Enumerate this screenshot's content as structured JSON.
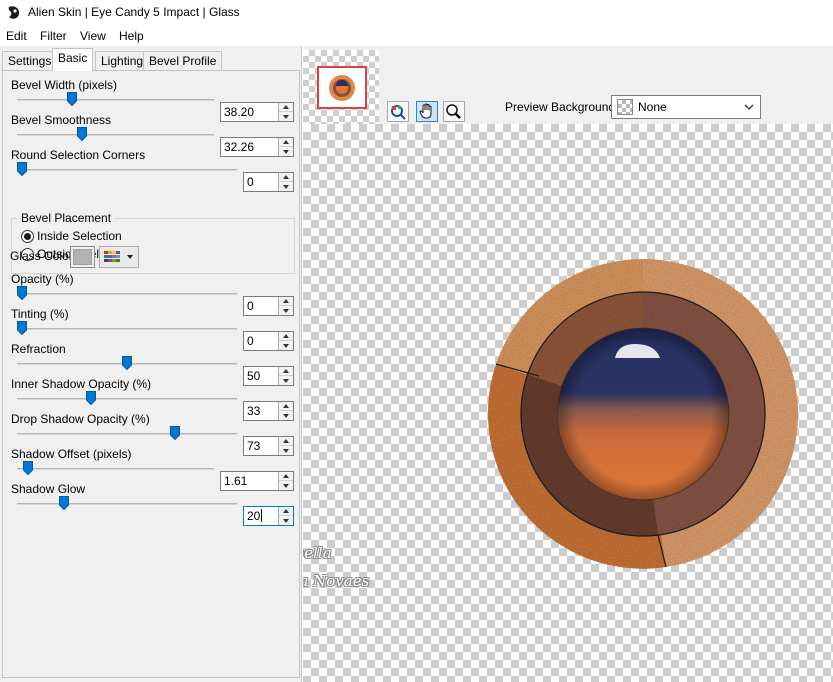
{
  "window": {
    "title": "Alien Skin | Eye Candy 5 Impact | Glass"
  },
  "menu": [
    "Edit",
    "Filter",
    "View",
    "Help"
  ],
  "tabs": [
    {
      "label": "Settings",
      "active": false
    },
    {
      "label": "Basic",
      "active": true
    },
    {
      "label": "Lighting",
      "active": false
    },
    {
      "label": "Bevel Profile",
      "active": false
    }
  ],
  "params": [
    {
      "label": "Bevel Width (pixels)",
      "value": "38.20",
      "level": 0.27
    },
    {
      "label": "Bevel Smoothness",
      "value": "32.26",
      "level": 0.32
    },
    {
      "label": "Round Selection Corners",
      "value": "0",
      "level": 0.0
    },
    {
      "label": "Opacity (%)",
      "value": "0",
      "level": 0.0
    },
    {
      "label": "Tinting (%)",
      "value": "0",
      "level": 0.0
    },
    {
      "label": "Refraction",
      "value": "50",
      "level": 0.5
    },
    {
      "label": "Inner Shadow Opacity (%)",
      "value": "33",
      "level": 0.33
    },
    {
      "label": "Drop Shadow Opacity (%)",
      "value": "73",
      "level": 0.73
    },
    {
      "label": "Shadow Offset (pixels)",
      "value": "1.61",
      "level": 0.03
    },
    {
      "label": "Shadow Glow",
      "value": "20",
      "level": 0.2
    }
  ],
  "bevel_placement": {
    "legend": "Bevel Placement",
    "inside": "Inside Selection",
    "outside": "Outside Selection",
    "selected": "inside"
  },
  "glass_color": {
    "label": "Glass Color",
    "color": "#b3b1b2"
  },
  "preview": {
    "background_label": "Preview Background:",
    "background_value": "None",
    "tools": [
      "zoom-region-icon",
      "hand-icon",
      "magnifier-icon"
    ]
  },
  "watermark": {
    "line1": "Tuto by_Suizabella",
    "line2": "Tradução by_Neusa Novaes"
  },
  "colors": {
    "accent": "#0078d7",
    "glass_top": "#243163",
    "glass_bottom": "#e2773a",
    "outer_ring": "#d68a4c",
    "inner_ring": "#8a4f37"
  }
}
